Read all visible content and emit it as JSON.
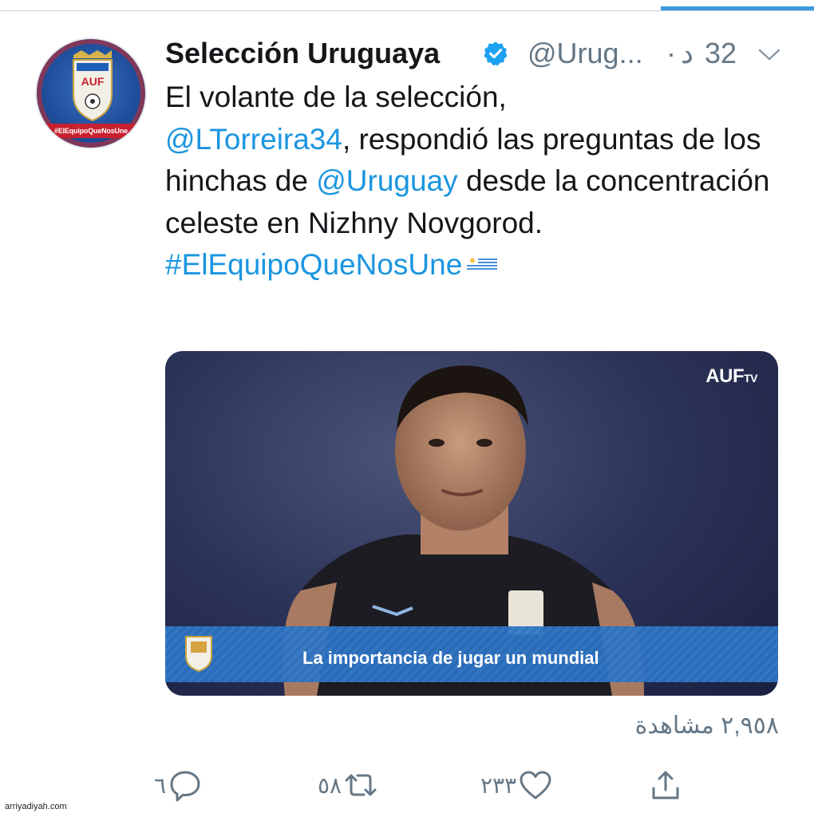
{
  "tweet": {
    "author": {
      "display_name": "Selección Uruguaya",
      "handle": "@Urug...",
      "verified": true,
      "avatar_banner": "#ElEquipoQueNosUne",
      "avatar_crest_text": "AUF"
    },
    "time": {
      "separator": "·",
      "unit": "د",
      "value": "32"
    },
    "text": {
      "line1": "El volante de la selección,",
      "mention1": "@LTorreira34",
      "part2": ", respondió las preguntas de los hinchas de ",
      "mention2": "@Uruguay",
      "part3": " desde la concentración celeste en Nizhny Novgorod.",
      "hashtag": "#ElEquipoQueNosUne"
    },
    "media": {
      "watermark": "AUF",
      "watermark_suffix": "TV",
      "caption": "La importancia de jugar un mundial"
    },
    "views": "٢,٩٥٨ مشاهدة",
    "actions": {
      "replies": "٦",
      "retweets": "٥٨",
      "likes": "٢٣٣"
    }
  },
  "site_watermark": "arriyadiyah.com",
  "colors": {
    "link": "#1b95e0",
    "muted": "#657786",
    "verified": "#1da1f2",
    "progress": "#3b99e0"
  }
}
